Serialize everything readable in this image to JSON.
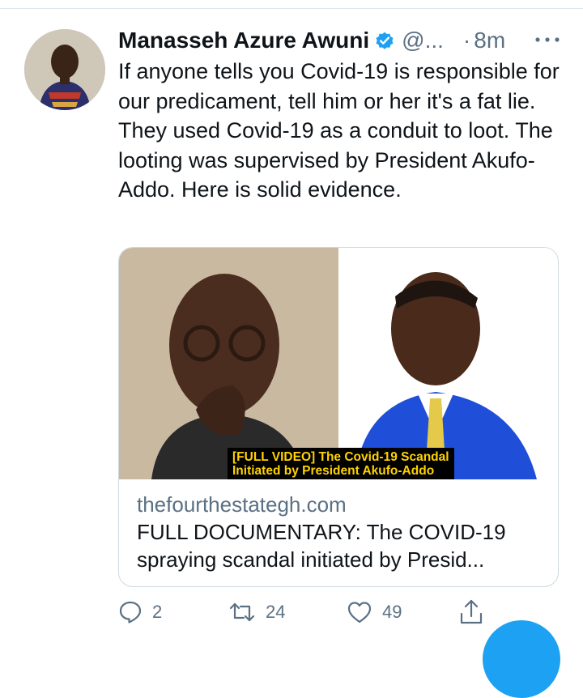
{
  "tweet": {
    "author_name": "Manasseh Azure Awuni",
    "handle": "@...",
    "time_separator": "·",
    "time": "8m",
    "text": "If anyone tells you Covid-19 is responsible for our predicament, tell him or her it's a fat lie. They used Covid-19 as a conduit to loot. The looting was supervised by President Akufo-Addo. Here is solid evidence."
  },
  "card": {
    "caption_line1": "[FULL VIDEO] The Covid-19 Scandal",
    "caption_line2": "Initiated by President Akufo-Addo",
    "domain": "thefourthestategh.com",
    "title": "FULL DOCUMENTARY: The COVID-19 spraying scandal initiated by Presid..."
  },
  "actions": {
    "reply_count": "2",
    "retweet_count": "24",
    "like_count": "49"
  },
  "icons": {
    "verified": "verified-badge-icon",
    "more": "more-options-icon",
    "reply": "reply-icon",
    "retweet": "retweet-icon",
    "like": "heart-icon",
    "share": "share-icon"
  },
  "colors": {
    "accent": "#1da1f2",
    "secondary_text": "#5b7083",
    "caption_text": "#ffd200"
  }
}
